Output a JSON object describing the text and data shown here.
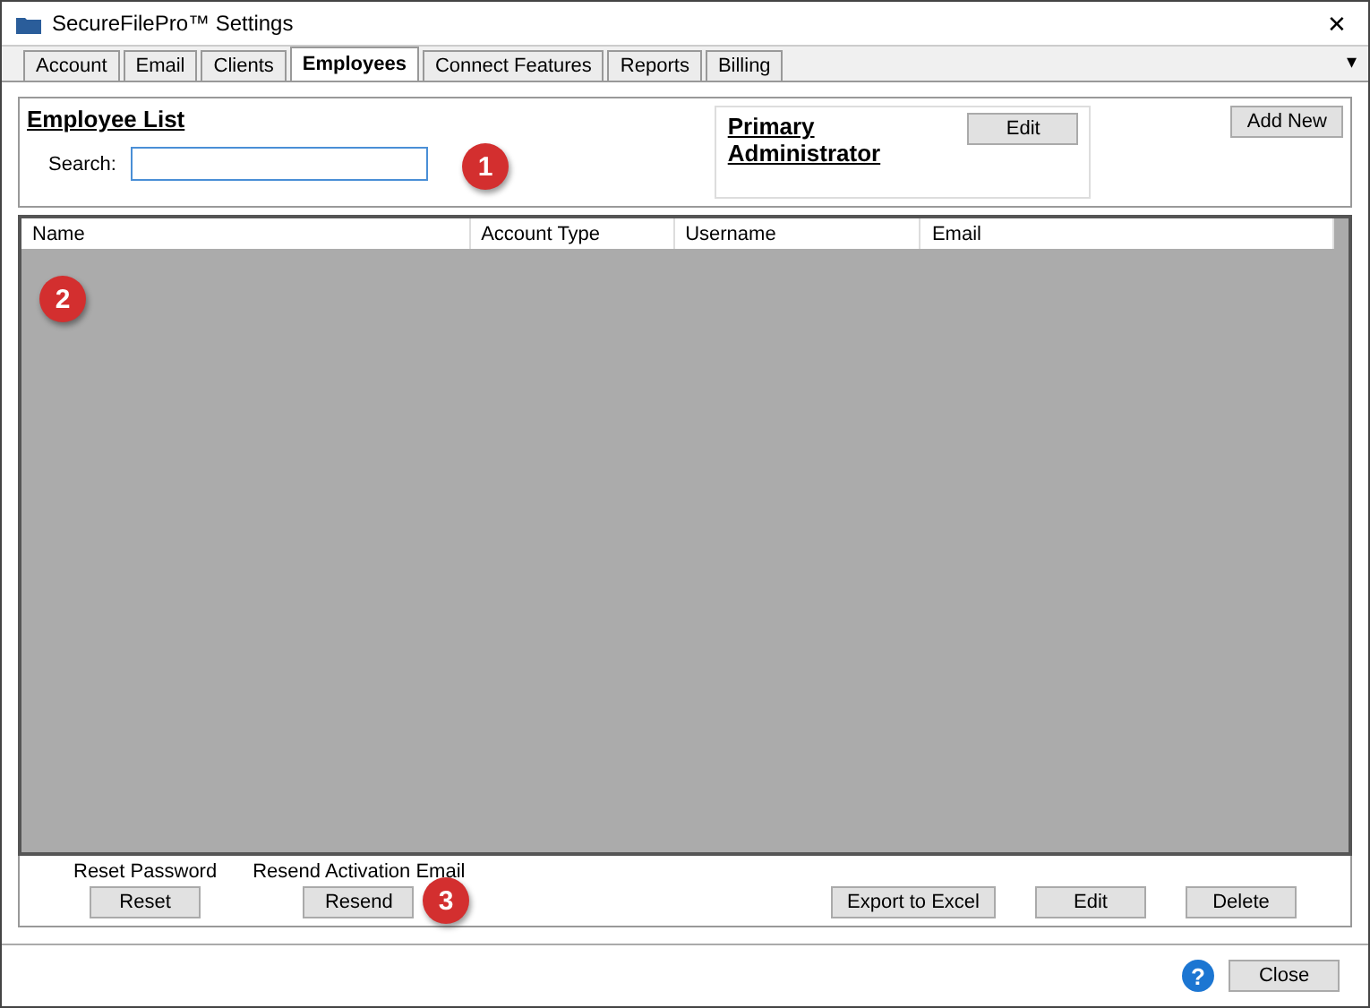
{
  "window": {
    "title": "SecureFilePro™ Settings",
    "close": "✕"
  },
  "tabs": [
    {
      "label": "Account",
      "selected": false
    },
    {
      "label": "Email",
      "selected": false
    },
    {
      "label": "Clients",
      "selected": false
    },
    {
      "label": "Employees",
      "selected": true
    },
    {
      "label": "Connect Features",
      "selected": false
    },
    {
      "label": "Reports",
      "selected": false
    },
    {
      "label": "Billing",
      "selected": false
    }
  ],
  "tab_menu": "▾",
  "employee_list": {
    "title": "Employee List",
    "search_label": "Search:"
  },
  "primary_admin": {
    "title": "Primary Administrator",
    "edit": "Edit"
  },
  "add_new": "Add New",
  "table": {
    "columns": [
      "Name",
      "Account Type",
      "Username",
      "Email"
    ]
  },
  "reset": {
    "label": "Reset Password",
    "button": "Reset"
  },
  "resend": {
    "label": "Resend Activation Email",
    "button": "Resend"
  },
  "actions": [
    "Export to Excel",
    "Edit",
    "Delete"
  ],
  "callouts": [
    "1",
    "2",
    "3"
  ],
  "footer": {
    "help": "?",
    "close": "Close"
  }
}
